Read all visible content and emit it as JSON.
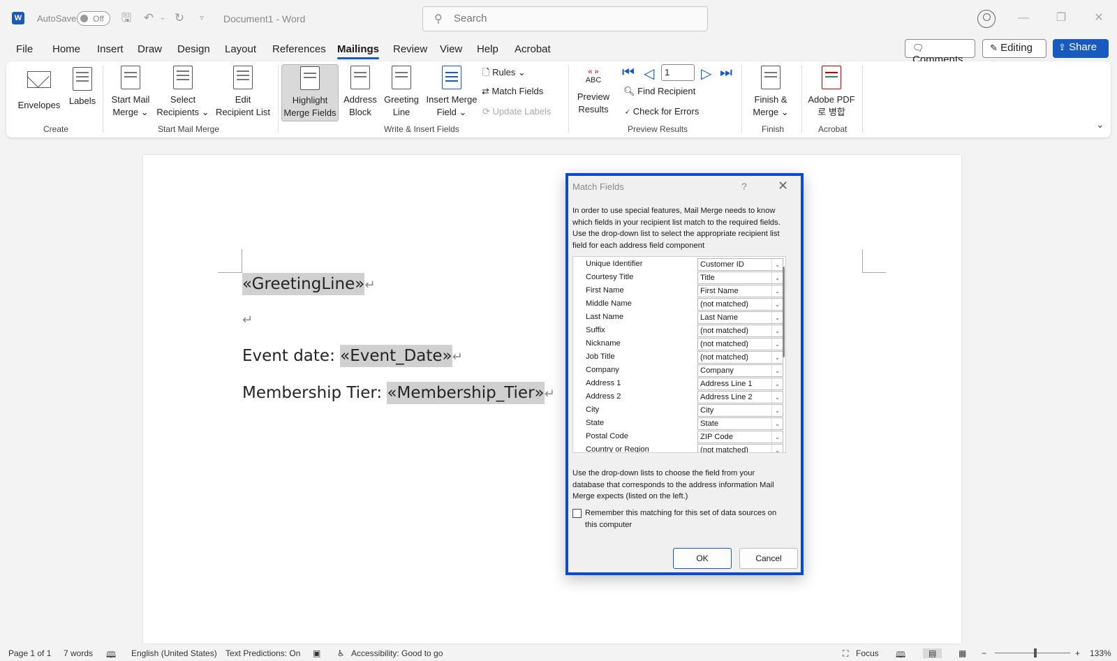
{
  "titlebar": {
    "autosave_label": "AutoSave",
    "autosave_state": "Off",
    "document_title": "Document1  -  Word",
    "search_placeholder": "Search"
  },
  "tabs": [
    "File",
    "Home",
    "Insert",
    "Draw",
    "Design",
    "Layout",
    "References",
    "Mailings",
    "Review",
    "View",
    "Help",
    "Acrobat"
  ],
  "active_tab": "Mailings",
  "top_right": {
    "comments": "Comments",
    "editing": "Editing",
    "share": "Share"
  },
  "ribbon": {
    "create": {
      "label": "Create",
      "envelopes": "Envelopes",
      "labels": "Labels"
    },
    "start_mail_merge": {
      "label": "Start Mail Merge",
      "start_1": "Start Mail",
      "start_2": "Merge ⌄",
      "select_1": "Select",
      "select_2": "Recipients ⌄",
      "edit_1": "Edit",
      "edit_2": "Recipient List"
    },
    "write_insert": {
      "label": "Write & Insert Fields",
      "highlight_1": "Highlight",
      "highlight_2": "Merge Fields",
      "address_1": "Address",
      "address_2": "Block",
      "greeting_1": "Greeting",
      "greeting_2": "Line",
      "insert_1": "Insert Merge",
      "insert_2": "Field ⌄",
      "rules": "Rules ⌄",
      "match_fields": "Match Fields",
      "update_labels": "Update Labels"
    },
    "preview": {
      "label": "Preview Results",
      "preview_1": "Preview",
      "preview_2": "Results",
      "abc": "ABC",
      "record": "1",
      "find_recipient": "Find Recipient",
      "check_errors": "Check for Errors"
    },
    "finish": {
      "label": "Finish",
      "finish_1": "Finish &",
      "finish_2": "Merge ⌄"
    },
    "acrobat": {
      "label": "Acrobat",
      "adobe_1": "Adobe PDF",
      "adobe_2": "로 병합"
    }
  },
  "document": {
    "greeting": "«GreetingLine»",
    "event_label": "Event date: ",
    "event_field": "«Event_Date»",
    "tier_label": "Membership Tier: ",
    "tier_field": "«Membership_Tier»",
    "para_mark": "↵"
  },
  "dialog": {
    "title": "Match Fields",
    "help": "?",
    "intro": "In order to use special features, Mail Merge needs to know which fields in your recipient list match to the required fields. Use the drop-down list to select the appropriate recipient list field for each address field component",
    "fields": [
      {
        "label": "Unique Identifier",
        "value": "Customer ID"
      },
      {
        "label": "Courtesy Title",
        "value": "Title"
      },
      {
        "label": "First Name",
        "value": "First Name"
      },
      {
        "label": "Middle Name",
        "value": "(not matched)"
      },
      {
        "label": "Last Name",
        "value": "Last Name"
      },
      {
        "label": "Suffix",
        "value": "(not matched)"
      },
      {
        "label": "Nickname",
        "value": "(not matched)"
      },
      {
        "label": "Job Title",
        "value": "(not matched)"
      },
      {
        "label": "Company",
        "value": "Company"
      },
      {
        "label": "Address 1",
        "value": "Address Line 1"
      },
      {
        "label": "Address 2",
        "value": "Address Line 2"
      },
      {
        "label": "City",
        "value": "City"
      },
      {
        "label": "State",
        "value": "State"
      },
      {
        "label": "Postal Code",
        "value": "ZIP Code"
      },
      {
        "label": "Country or Region",
        "value": "(not matched)"
      }
    ],
    "footer_text": "Use the drop-down lists to choose the field from your database that corresponds to the address information Mail Merge expects (listed on the left.)",
    "remember_text": "Remember this matching for this set of data sources on this computer",
    "ok": "OK",
    "cancel": "Cancel"
  },
  "statusbar": {
    "page": "Page 1 of 1",
    "words": "7 words",
    "language": "English (United States)",
    "predictions": "Text Predictions: On",
    "accessibility": "Accessibility: Good to go",
    "focus": "Focus",
    "zoom": "133%"
  },
  "colors": {
    "accent": "#185abd",
    "dialog_border": "#0a4bd6",
    "merge_field_bg": "#d0d0d0"
  }
}
